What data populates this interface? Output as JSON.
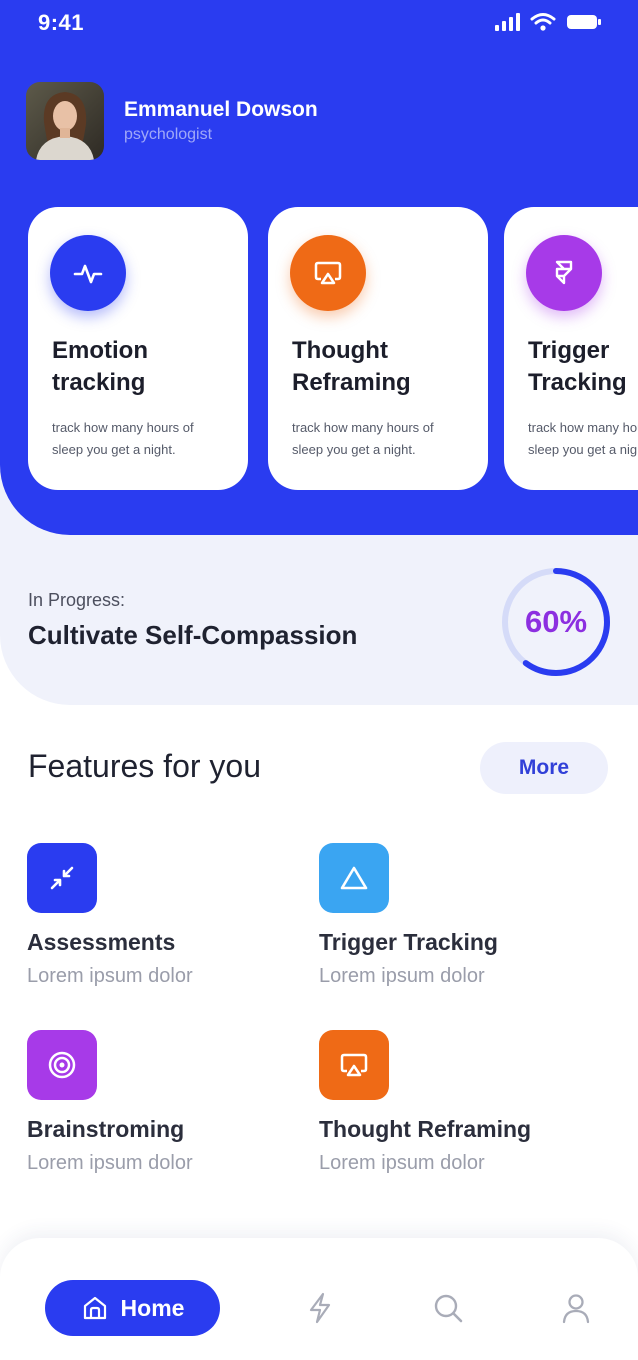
{
  "status_bar": {
    "time": "9:41"
  },
  "profile": {
    "name": "Emmanuel Dowson",
    "role": "psychologist"
  },
  "cards": [
    {
      "title_line1": "Emotion",
      "title_line2": "tracking",
      "desc_line1": "track how many hours of",
      "desc_line2": "sleep you get a night.",
      "icon": "pulse-icon",
      "color": "#2a3cf0"
    },
    {
      "title_line1": "Thought",
      "title_line2": "Reframing",
      "desc_line1": "track how many hours of",
      "desc_line2": "sleep you get a night.",
      "icon": "cast-icon",
      "color": "#ef6a16"
    },
    {
      "title_line1": "Trigger",
      "title_line2": "Tracking",
      "desc_line1": "track how many hours of",
      "desc_line2": "sleep you get a night.",
      "icon": "framer-icon",
      "color": "#a73ae8"
    }
  ],
  "progress": {
    "label": "In Progress:",
    "title": "Cultivate Self-Compassion",
    "percent_text": "60%",
    "percent": 60
  },
  "features": {
    "title": "Features for you",
    "more_label": "More",
    "items": [
      {
        "title": "Assessments",
        "subtitle": "Lorem ipsum dolor",
        "icon": "minimize-icon",
        "color": "#2a3cf0"
      },
      {
        "title": "Trigger Tracking",
        "subtitle": "Lorem ipsum dolor",
        "icon": "triangle-icon",
        "color": "#3aa5f2"
      },
      {
        "title": "Brainstroming",
        "subtitle": "Lorem ipsum dolor",
        "icon": "target-icon",
        "color": "#a73ae8"
      },
      {
        "title": "Thought Reframing",
        "subtitle": "Lorem ipsum dolor",
        "icon": "cast-icon",
        "color": "#ef6a16"
      }
    ]
  },
  "nav": {
    "home_label": "Home"
  },
  "colors": {
    "primary": "#2a3cf0",
    "progress_text": "#8c2fe0",
    "panel": "#f0f2fb"
  }
}
